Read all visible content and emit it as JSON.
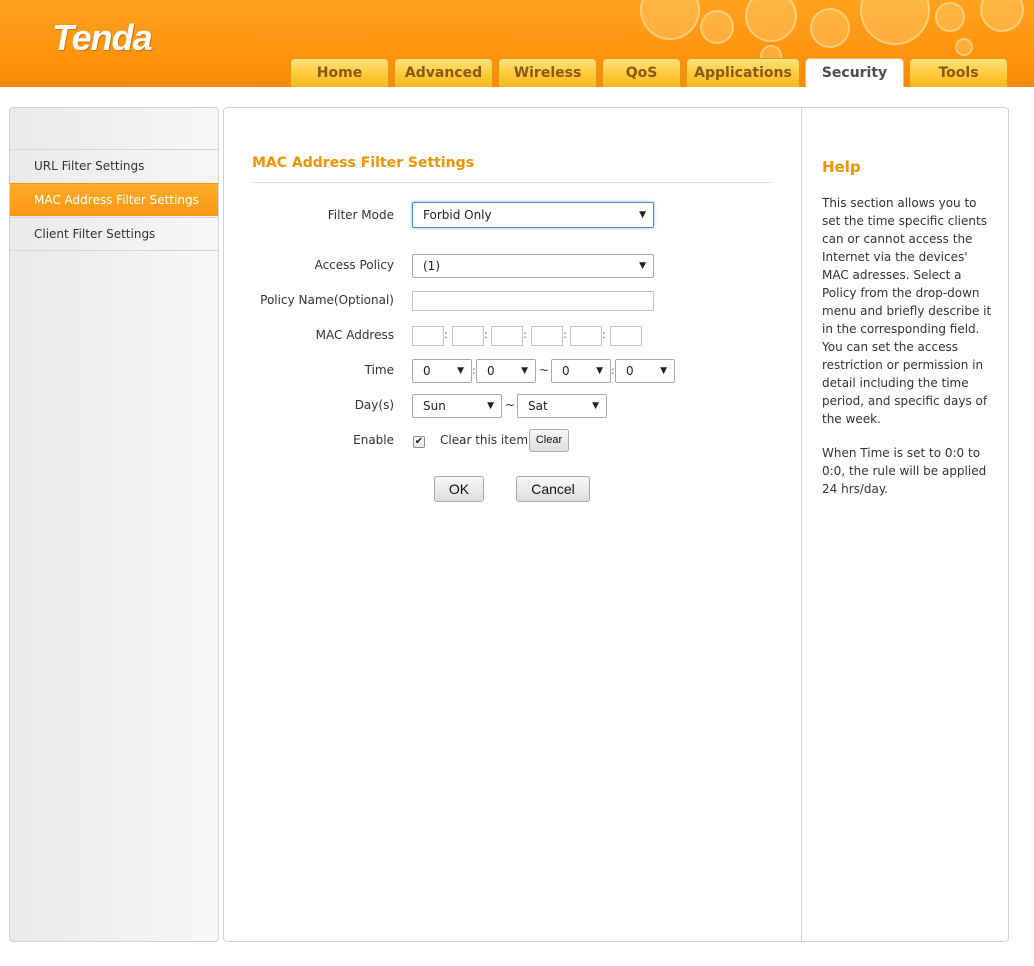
{
  "brand": {
    "logo_text": "Tenda"
  },
  "nav": {
    "tabs": [
      {
        "label": "Home"
      },
      {
        "label": "Advanced"
      },
      {
        "label": "Wireless"
      },
      {
        "label": "QoS"
      },
      {
        "label": "Applications"
      },
      {
        "label": "Security",
        "active": true
      },
      {
        "label": "Tools"
      }
    ]
  },
  "sidebar": {
    "items": [
      {
        "label": "URL Filter Settings"
      },
      {
        "label": "MAC Address Filter Settings",
        "active": true
      },
      {
        "label": "Client Filter Settings"
      }
    ]
  },
  "form": {
    "title": "MAC Address Filter Settings",
    "filter_mode": {
      "label": "Filter Mode",
      "value": "Forbid Only"
    },
    "access_policy": {
      "label": "Access Policy",
      "value": "(1)"
    },
    "policy_name": {
      "label": "Policy Name(Optional)",
      "value": ""
    },
    "mac_address": {
      "label": "MAC Address",
      "octets": [
        "",
        "",
        "",
        "",
        "",
        ""
      ],
      "separator": ":"
    },
    "time": {
      "label": "Time",
      "start_hour": "0",
      "start_min": "0",
      "end_hour": "0",
      "end_min": "0",
      "range_sep": "~",
      "colon": ":"
    },
    "days": {
      "label": "Day(s)",
      "start": "Sun",
      "end": "Sat",
      "range_sep": "~"
    },
    "enable": {
      "label": "Enable",
      "checked": true,
      "clear_label": "Clear this item:",
      "clear_button": "Clear"
    },
    "ok_button": "OK",
    "cancel_button": "Cancel"
  },
  "help": {
    "title": "Help",
    "paragraph1": "This section allows you to set the time specific clients can or cannot access the Internet via the devices' MAC adresses. Select a Policy from the drop-down menu and briefly describe it in the corresponding field. You can set the access restriction or permission in detail including the time period, and specific days of the week.",
    "paragraph2": "When Time is set to 0:0 to 0:0, the rule will be applied 24 hrs/day."
  },
  "colors": {
    "accent": "#f39200",
    "header": "#ff9410",
    "tab": "#ffc93a",
    "active_sidebar": "#fb9812"
  }
}
